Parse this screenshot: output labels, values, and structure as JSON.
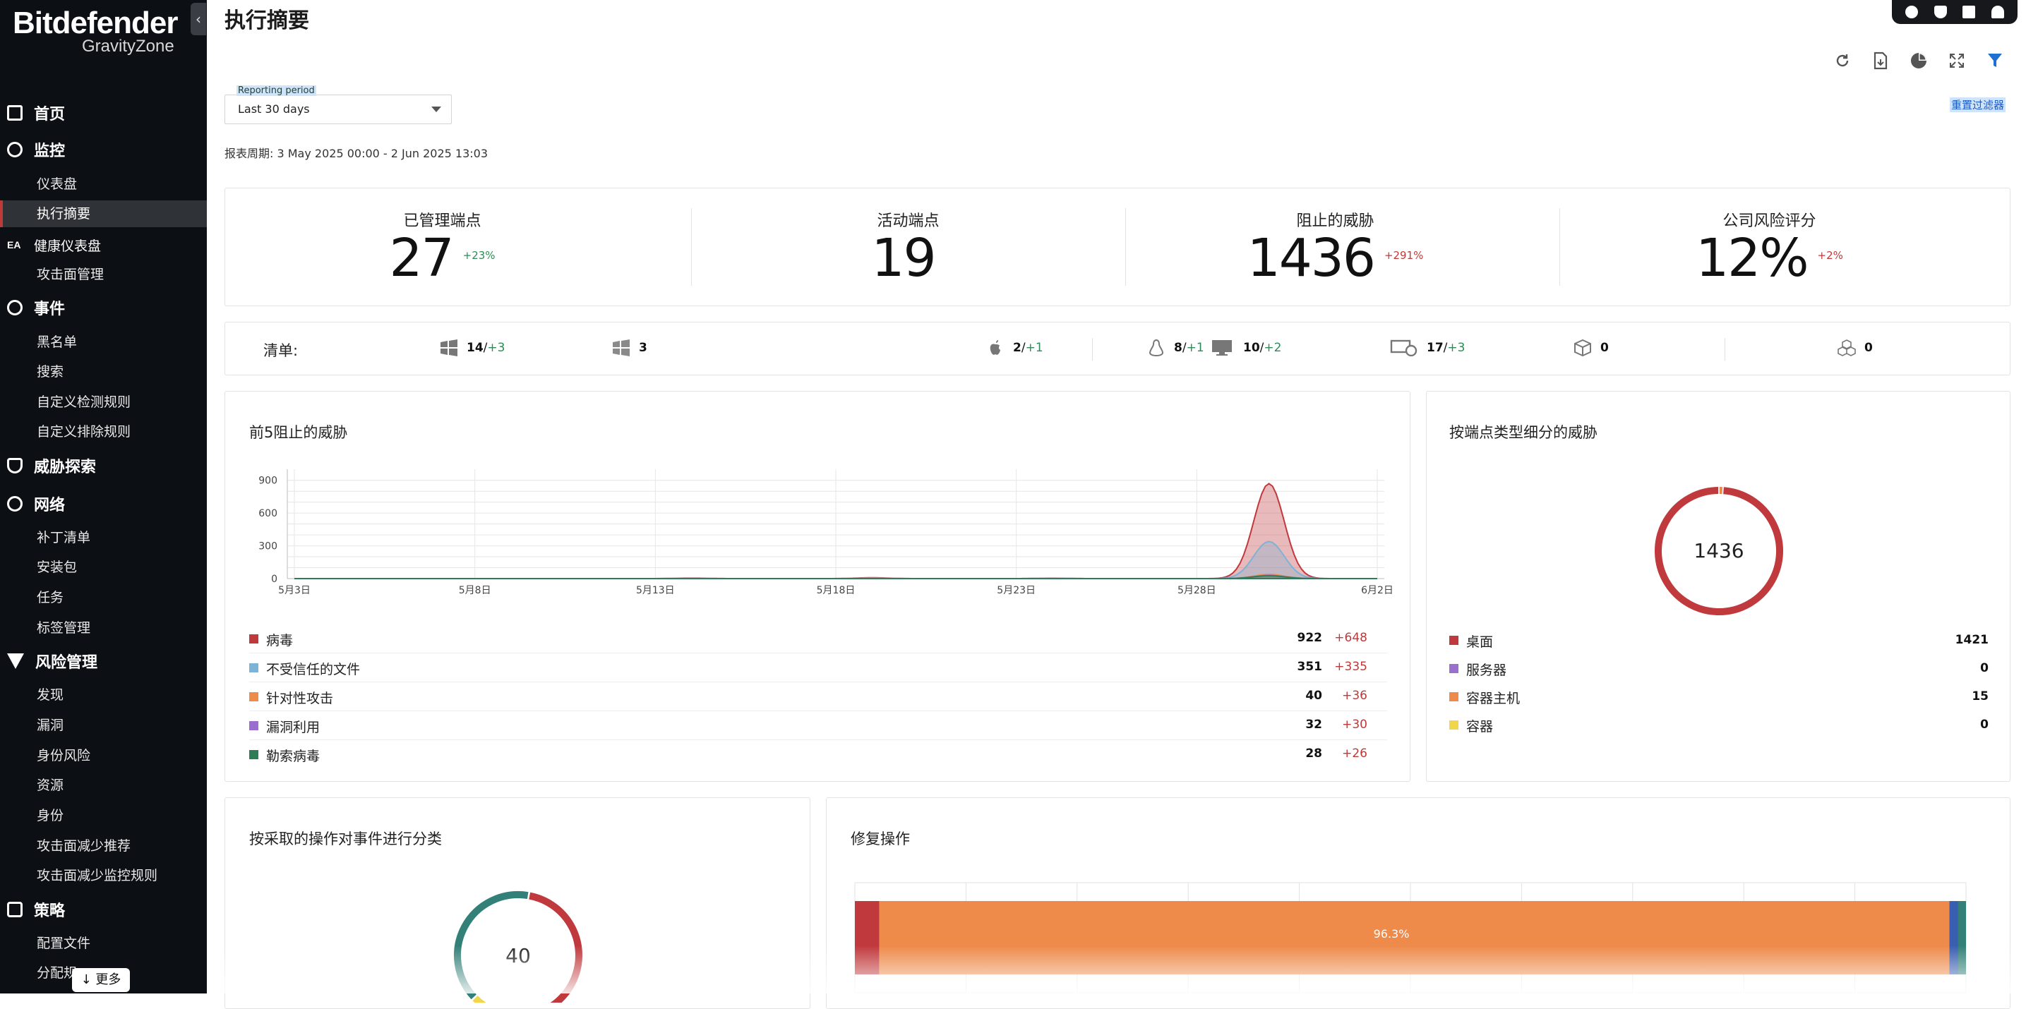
{
  "brand": {
    "name": "Bitdefender",
    "product": "GravityZone"
  },
  "sidebar": {
    "sections": [
      {
        "label": "首页",
        "icon": "home-icon"
      },
      {
        "label": "监控",
        "icon": "monitor-icon",
        "items": [
          "仪表盘",
          "执行摘要"
        ]
      },
      {
        "label": "健康仪表盘",
        "icon": "ea-badge-icon",
        "badge": "EA"
      },
      {
        "label": "攻击面管理"
      },
      {
        "label": "事件",
        "icon": "incidents-icon",
        "items": [
          "黑名单",
          "搜索",
          "自定义检测规则",
          "自定义排除规则"
        ]
      },
      {
        "label": "威胁探索",
        "icon": "shield-icon"
      },
      {
        "label": "网络",
        "icon": "network-icon",
        "items": [
          "补丁清单",
          "安装包",
          "任务",
          "标签管理"
        ]
      },
      {
        "label": "风险管理",
        "icon": "risk-icon",
        "items": [
          "发现",
          "漏洞",
          "身份风险",
          "资源",
          "身份",
          "攻击面减少推荐",
          "攻击面减少监控规则"
        ]
      },
      {
        "label": "策略",
        "icon": "policy-icon",
        "items": [
          "配置文件",
          "分配规"
        ]
      }
    ],
    "active_item": "执行摘要",
    "more_label": "↓ 更多"
  },
  "header": {
    "title": "执行摘要",
    "reporting_period_label": "Reporting period",
    "reporting_period_value": "Last 30 days",
    "reset_filters": "重置过滤器",
    "report_range": "报表周期: 3 May 2025 00:00 - 2 Jun 2025 13:03"
  },
  "toolbar_icons": [
    "user-icon",
    "shield-icon",
    "gift-icon",
    "bell-icon"
  ],
  "action_icons": [
    "refresh-icon",
    "export-icon",
    "pie-chart-icon",
    "fullscreen-icon",
    "filter-icon"
  ],
  "kpis": [
    {
      "label": "已管理端点",
      "value": "27",
      "delta": "+23%",
      "delta_color": "#2e8b57"
    },
    {
      "label": "活动端点",
      "value": "19",
      "delta": "",
      "delta_color": "#2e8b57"
    },
    {
      "label": "阻止的威胁",
      "value": "1436",
      "delta": "+291%",
      "delta_color": "#c03939"
    },
    {
      "label": "公司风险评分",
      "value": "12%",
      "delta": "+2%",
      "delta_color": "#c03939"
    }
  ],
  "inventory": {
    "label": "清单:",
    "items": [
      {
        "icon": "windows-workstation-icon",
        "count": "14",
        "delta": "+3"
      },
      {
        "icon": "windows-server-icon",
        "count": "3",
        "delta": ""
      },
      {
        "icon": "apple-icon",
        "count": "2",
        "delta": "+1"
      },
      {
        "icon": "linux-icon",
        "count": "8",
        "delta": "+1"
      },
      {
        "icon": "desktop-icon",
        "count": "10",
        "delta": "+2"
      },
      {
        "icon": "laptop-server-icon",
        "count": "17",
        "delta": "+3"
      },
      {
        "icon": "container-icon",
        "count": "0",
        "delta": ""
      },
      {
        "icon": "container-host-icon",
        "count": "0",
        "delta": ""
      }
    ]
  },
  "top5": {
    "title": "前5阻止的威胁",
    "legend": [
      {
        "name": "病毒",
        "value": "922",
        "delta": "+648",
        "color": "#c0393d"
      },
      {
        "name": "不受信任的文件",
        "value": "351",
        "delta": "+335",
        "color": "#7db3d6"
      },
      {
        "name": "针对性攻击",
        "value": "40",
        "delta": "+36",
        "color": "#ee8a4a"
      },
      {
        "name": "漏洞利用",
        "value": "32",
        "delta": "+30",
        "color": "#9b6fd0"
      },
      {
        "name": "勒索病毒",
        "value": "28",
        "delta": "+26",
        "color": "#2f7d56"
      }
    ]
  },
  "chart_data": {
    "type": "area",
    "title": "前5阻止的威胁",
    "x": [
      "5月3日",
      "5月4日",
      "5月5日",
      "5月6日",
      "5月7日",
      "5月8日",
      "5月9日",
      "5月10日",
      "5月11日",
      "5月12日",
      "5月13日",
      "5月14日",
      "5月15日",
      "5月16日",
      "5月17日",
      "5月18日",
      "5月19日",
      "5月20日",
      "5月21日",
      "5月22日",
      "5月23日",
      "5月24日",
      "5月25日",
      "5月26日",
      "5月27日",
      "5月28日",
      "5月29日",
      "5月30日",
      "5月31日",
      "6月1日",
      "6月2日"
    ],
    "x_tick_labels": [
      "5月3日",
      "5月8日",
      "5月13日",
      "5月18日",
      "5月23日",
      "5月28日",
      "6月2日"
    ],
    "y_ticks": [
      0,
      300,
      600,
      900
    ],
    "ylim": [
      0,
      950
    ],
    "series": [
      {
        "name": "病毒",
        "color": "#c0393d",
        "values": [
          0,
          0,
          0,
          0,
          0,
          0,
          0,
          0,
          0,
          0,
          0,
          4,
          0,
          0,
          0,
          0,
          8,
          0,
          0,
          0,
          0,
          3,
          0,
          0,
          0,
          0,
          0,
          870,
          0,
          0,
          0
        ]
      },
      {
        "name": "不受信任的文件",
        "color": "#7db3d6",
        "values": [
          0,
          0,
          0,
          0,
          0,
          0,
          0,
          0,
          0,
          0,
          0,
          2,
          0,
          0,
          0,
          0,
          4,
          0,
          0,
          0,
          0,
          2,
          0,
          0,
          0,
          0,
          0,
          340,
          0,
          0,
          0
        ]
      },
      {
        "name": "针对性攻击",
        "color": "#ee8a4a",
        "values": [
          0,
          0,
          0,
          0,
          0,
          0,
          0,
          0,
          0,
          0,
          0,
          0,
          0,
          0,
          0,
          0,
          1,
          0,
          0,
          0,
          0,
          0,
          0,
          0,
          0,
          0,
          0,
          38,
          0,
          0,
          0
        ]
      },
      {
        "name": "漏洞利用",
        "color": "#9b6fd0",
        "values": [
          0,
          0,
          0,
          0,
          0,
          0,
          0,
          0,
          0,
          0,
          0,
          0,
          0,
          0,
          0,
          0,
          0,
          0,
          0,
          0,
          0,
          0,
          0,
          0,
          0,
          0,
          0,
          30,
          0,
          0,
          0
        ]
      },
      {
        "name": "勒索病毒",
        "color": "#2f7d56",
        "values": [
          0,
          0,
          0,
          0,
          0,
          0,
          0,
          0,
          0,
          0,
          0,
          0,
          0,
          0,
          0,
          0,
          0,
          0,
          0,
          0,
          0,
          0,
          0,
          0,
          0,
          0,
          0,
          26,
          0,
          0,
          0
        ]
      }
    ]
  },
  "endpoint_types": {
    "title": "按端点类型细分的威胁",
    "total": "1436",
    "items": [
      {
        "name": "桌面",
        "value": "1421",
        "color": "#c0393d"
      },
      {
        "name": "服务器",
        "value": "0",
        "color": "#9b6fd0"
      },
      {
        "name": "容器主机",
        "value": "15",
        "color": "#ee8a4a"
      },
      {
        "name": "容器",
        "value": "0",
        "color": "#f1d54b"
      }
    ]
  },
  "actions": {
    "title": "按采取的操作对事件进行分类",
    "total": "40",
    "segments": [
      {
        "value": 0.55,
        "color": "#c0393d"
      },
      {
        "value": 0.05,
        "color": "#f1d54b"
      },
      {
        "value": 0.4,
        "color": "#338078"
      }
    ]
  },
  "remediation": {
    "title": "修复操作",
    "label": "96.3%",
    "segments": [
      {
        "value": 0.022,
        "color": "#c0393d"
      },
      {
        "value": 0.963,
        "color": "#ee8a4a"
      },
      {
        "value": 0.008,
        "color": "#3a5fb0"
      },
      {
        "value": 0.007,
        "color": "#338078"
      }
    ]
  }
}
